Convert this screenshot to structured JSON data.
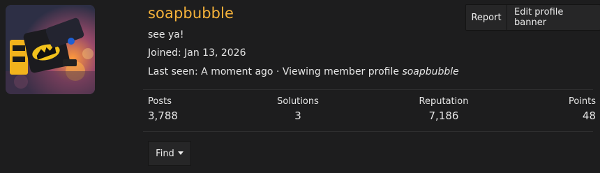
{
  "profile": {
    "username": "soapbubble",
    "status": "see ya!",
    "joined": "Joined: Jan 13, 2026",
    "last_seen": "Last seen: A moment ago · Viewing member profile ",
    "viewing_user": "soapbubble"
  },
  "actions": {
    "report_label": "Report",
    "edit_banner_label": "Edit profile banner",
    "find_label": "Find"
  },
  "stats": [
    {
      "label": "Posts",
      "value": "3,788"
    },
    {
      "label": "Solutions",
      "value": "3"
    },
    {
      "label": "Reputation",
      "value": "7,186"
    },
    {
      "label": "Points",
      "value": "48"
    }
  ],
  "icons": {
    "find_caret": "caret-down-icon"
  },
  "colors": {
    "username": "#f5b23a",
    "background": "#1d1d1e",
    "button": "#262627"
  }
}
